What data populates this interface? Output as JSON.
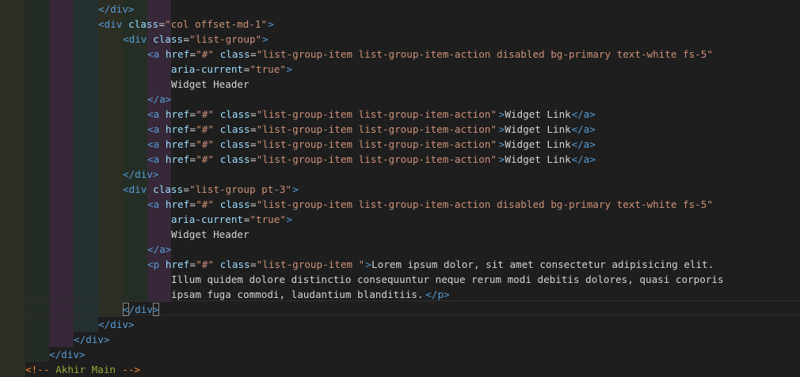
{
  "editor": {
    "language": "html",
    "indent_guide_colors": [
      "#2b2e22",
      "#242d24",
      "#362838",
      "#243031",
      "#2c2d23",
      "#242e24",
      "#362838"
    ],
    "lines": [
      {
        "tokens": [
          {
            "k": "tag",
            "t": "</div>"
          }
        ]
      },
      {
        "tokens": [
          {
            "k": "tag",
            "t": "<div"
          },
          {
            "k": "attr",
            "t": " class"
          },
          {
            "k": "text",
            "t": "="
          },
          {
            "k": "str",
            "t": "\"col offset-md-1\""
          },
          {
            "k": "tag",
            "t": ">"
          }
        ]
      },
      {
        "tokens": [
          {
            "k": "tag",
            "t": "<div"
          },
          {
            "k": "attr",
            "t": " class"
          },
          {
            "k": "text",
            "t": "="
          },
          {
            "k": "str",
            "t": "\"list-group\""
          },
          {
            "k": "tag",
            "t": ">"
          }
        ]
      },
      {
        "tokens": [
          {
            "k": "tag",
            "t": "<a"
          },
          {
            "k": "attr",
            "t": " href"
          },
          {
            "k": "text",
            "t": "="
          },
          {
            "k": "str",
            "t": "\"#\""
          },
          {
            "k": "attr",
            "t": " class"
          },
          {
            "k": "text",
            "t": "="
          },
          {
            "k": "str",
            "t": "\"list-group-item list-group-item-action disabled bg-primary text-white fs-5\""
          }
        ]
      },
      {
        "tokens": [
          {
            "k": "attr",
            "t": "aria-current"
          },
          {
            "k": "text",
            "t": "="
          },
          {
            "k": "str",
            "t": "\"true\""
          },
          {
            "k": "tag",
            "t": ">"
          }
        ]
      },
      {
        "tokens": [
          {
            "k": "text",
            "t": "Widget Header"
          }
        ]
      },
      {
        "tokens": [
          {
            "k": "tag",
            "t": "</a>"
          }
        ]
      },
      {
        "tokens": [
          {
            "k": "tag",
            "t": "<a"
          },
          {
            "k": "attr",
            "t": " href"
          },
          {
            "k": "text",
            "t": "="
          },
          {
            "k": "str",
            "t": "\"#\""
          },
          {
            "k": "attr",
            "t": " class"
          },
          {
            "k": "text",
            "t": "="
          },
          {
            "k": "str",
            "t": "\"list-group-item list-group-item-action\""
          },
          {
            "k": "tag",
            "t": ">"
          },
          {
            "k": "text",
            "t": "Widget Link"
          },
          {
            "k": "tag",
            "t": "</a>"
          }
        ]
      },
      {
        "tokens": [
          {
            "k": "tag",
            "t": "<a"
          },
          {
            "k": "attr",
            "t": " href"
          },
          {
            "k": "text",
            "t": "="
          },
          {
            "k": "str",
            "t": "\"#\""
          },
          {
            "k": "attr",
            "t": " class"
          },
          {
            "k": "text",
            "t": "="
          },
          {
            "k": "str",
            "t": "\"list-group-item list-group-item-action\""
          },
          {
            "k": "tag",
            "t": ">"
          },
          {
            "k": "text",
            "t": "Widget Link"
          },
          {
            "k": "tag",
            "t": "</a>"
          }
        ]
      },
      {
        "tokens": [
          {
            "k": "tag",
            "t": "<a"
          },
          {
            "k": "attr",
            "t": " href"
          },
          {
            "k": "text",
            "t": "="
          },
          {
            "k": "str",
            "t": "\"#\""
          },
          {
            "k": "attr",
            "t": " class"
          },
          {
            "k": "text",
            "t": "="
          },
          {
            "k": "str",
            "t": "\"list-group-item list-group-item-action\""
          },
          {
            "k": "tag",
            "t": ">"
          },
          {
            "k": "text",
            "t": "Widget Link"
          },
          {
            "k": "tag",
            "t": "</a>"
          }
        ]
      },
      {
        "tokens": [
          {
            "k": "tag",
            "t": "<a"
          },
          {
            "k": "attr",
            "t": " href"
          },
          {
            "k": "text",
            "t": "="
          },
          {
            "k": "str",
            "t": "\"#\""
          },
          {
            "k": "attr",
            "t": " class"
          },
          {
            "k": "text",
            "t": "="
          },
          {
            "k": "str",
            "t": "\"list-group-item list-group-item-action\""
          },
          {
            "k": "tag",
            "t": ">"
          },
          {
            "k": "text",
            "t": "Widget Link"
          },
          {
            "k": "tag",
            "t": "</a>"
          }
        ]
      },
      {
        "tokens": [
          {
            "k": "tag",
            "t": "</div>"
          }
        ]
      },
      {
        "tokens": [
          {
            "k": "tag",
            "t": "<div"
          },
          {
            "k": "attr",
            "t": " class"
          },
          {
            "k": "text",
            "t": "="
          },
          {
            "k": "str",
            "t": "\"list-group pt-3\""
          },
          {
            "k": "tag",
            "t": ">"
          }
        ]
      },
      {
        "tokens": [
          {
            "k": "tag",
            "t": "<a"
          },
          {
            "k": "attr",
            "t": " href"
          },
          {
            "k": "text",
            "t": "="
          },
          {
            "k": "str",
            "t": "\"#\""
          },
          {
            "k": "attr",
            "t": " class"
          },
          {
            "k": "text",
            "t": "="
          },
          {
            "k": "str",
            "t": "\"list-group-item list-group-item-action disabled bg-primary text-white fs-5\""
          }
        ]
      },
      {
        "tokens": [
          {
            "k": "attr",
            "t": "aria-current"
          },
          {
            "k": "text",
            "t": "="
          },
          {
            "k": "str",
            "t": "\"true\""
          },
          {
            "k": "tag",
            "t": ">"
          }
        ]
      },
      {
        "tokens": [
          {
            "k": "text",
            "t": "Widget Header"
          }
        ]
      },
      {
        "tokens": [
          {
            "k": "tag",
            "t": "</a>"
          }
        ]
      },
      {
        "tokens": [
          {
            "k": "tag",
            "t": "<p"
          },
          {
            "k": "attr",
            "t": " href"
          },
          {
            "k": "text",
            "t": "="
          },
          {
            "k": "str",
            "t": "\"#\""
          },
          {
            "k": "attr",
            "t": " class"
          },
          {
            "k": "text",
            "t": "="
          },
          {
            "k": "str",
            "t": "\"list-group-item \""
          },
          {
            "k": "tag",
            "t": ">"
          },
          {
            "k": "text",
            "t": "Lorem ipsum dolor, sit amet consectetur adipisicing elit."
          }
        ]
      },
      {
        "tokens": [
          {
            "k": "text",
            "t": "Illum quidem dolore distinctio consequuntur neque rerum modi debitis dolores, quasi corporis"
          }
        ]
      },
      {
        "tokens": [
          {
            "k": "text",
            "t": "ipsam fuga commodi, laudantium blanditiis."
          },
          {
            "k": "tag",
            "t": "</p>"
          }
        ]
      },
      {
        "tokens": [
          {
            "k": "tag",
            "t": "</div>"
          }
        ]
      },
      {
        "tokens": [
          {
            "k": "tag",
            "t": "</div>"
          }
        ]
      },
      {
        "tokens": [
          {
            "k": "tag",
            "t": "</div>"
          }
        ]
      },
      {
        "tokens": [
          {
            "k": "tag",
            "t": "</div>"
          }
        ]
      },
      {
        "tokens": [
          {
            "k": "cmtdelim",
            "t": "<!--"
          },
          {
            "k": "cmt",
            "t": " Akhir Main "
          },
          {
            "k": "cmtdelim",
            "t": "-->"
          }
        ]
      }
    ]
  }
}
